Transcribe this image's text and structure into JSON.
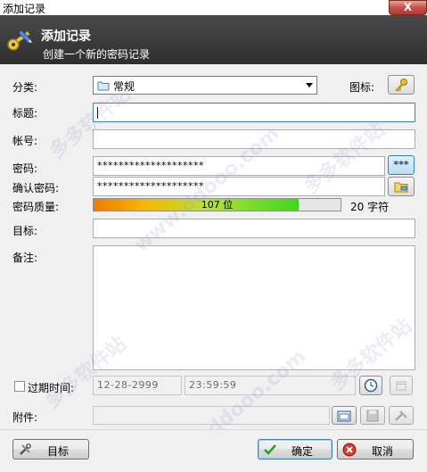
{
  "window": {
    "title": "添加记录",
    "close_label": "X"
  },
  "banner": {
    "title": "添加记录",
    "subtitle": "创建一个新的密码记录"
  },
  "form": {
    "category_label": "分类:",
    "category_value": "常规",
    "icon_label": "图标:",
    "title_label": "标题:",
    "title_value": "",
    "account_label": "帐号:",
    "account_value": "",
    "password_label": "密码:",
    "password_value": "********************",
    "confirm_label": "确认密码:",
    "confirm_value": "********************",
    "show_password_label": "***",
    "quality_label": "密码质量:",
    "quality_bits_text": "107 位",
    "quality_fraction": 0.83,
    "quality_chars_text": "20 字符",
    "target_label": "目标:",
    "target_value": "",
    "notes_label": "备注:",
    "notes_value": "",
    "expire_label": "过期时间:",
    "expire_checked": false,
    "expire_date": "12-28-2999",
    "expire_time": "23:59:59",
    "attachment_label": "附件:",
    "attachment_value": ""
  },
  "footer": {
    "target_button": "目标",
    "ok_button": "确定",
    "cancel_button": "取消"
  },
  "colors": {
    "banner_bg": "#3a3a3a",
    "quality_start": "#f07b00",
    "quality_end": "#3fd81a"
  }
}
